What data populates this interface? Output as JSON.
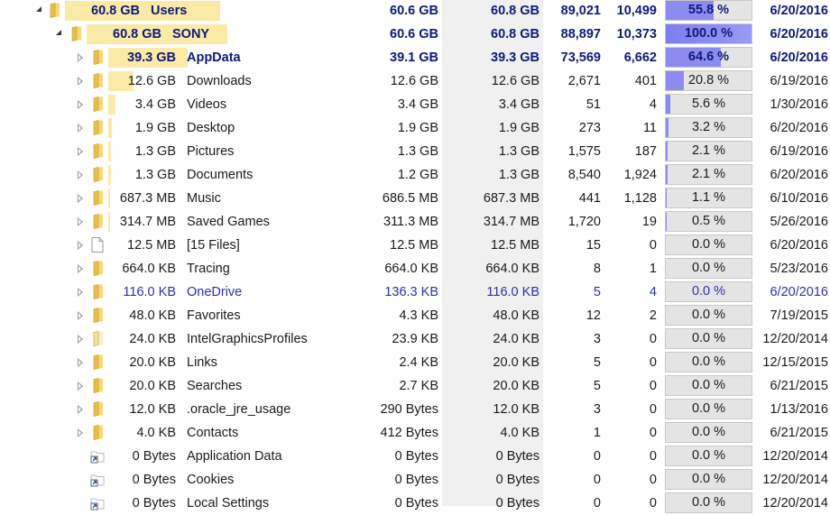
{
  "colors": {
    "size_bar": "#fbe9a6",
    "percent_fill": "#8c8cf0",
    "percent_bg": "#e4e4e4",
    "bold_text": "#0d1a7a",
    "link_text": "#2f2fb0",
    "allocated_column_bg": "#f0f0f0"
  },
  "rows": [
    {
      "level": 0,
      "expanded": true,
      "icon": "folder-icon",
      "style": "bold",
      "bar": 1.0,
      "size": "60.8 GB",
      "name": "Users",
      "size2": "60.6 GB",
      "allocated": "60.8 GB",
      "files": "89,021",
      "folders": "10,499",
      "percent": "55.8 %",
      "percent_value": 0.558,
      "date": "6/20/2016"
    },
    {
      "level": 1,
      "expanded": true,
      "icon": "folder-icon",
      "style": "bold",
      "bar": 1.0,
      "size": "60.8 GB",
      "name": "SONY",
      "size2": "60.6 GB",
      "allocated": "60.8 GB",
      "files": "88,897",
      "folders": "10,373",
      "percent": "100.0 %",
      "percent_value": 1.0,
      "date": "6/20/2016"
    },
    {
      "level": 2,
      "expanded": false,
      "icon": "folder-icon",
      "style": "bold",
      "bar": 1.0,
      "size": "39.3 GB",
      "name": "AppData",
      "size2": "39.1 GB",
      "allocated": "39.3 GB",
      "files": "73,569",
      "folders": "6,662",
      "percent": "64.6 %",
      "percent_value": 0.646,
      "date": "6/20/2016"
    },
    {
      "level": 2,
      "expanded": false,
      "icon": "folder-icon",
      "style": "normal",
      "bar": 0.32,
      "size": "12.6 GB",
      "name": "Downloads",
      "size2": "12.6 GB",
      "allocated": "12.6 GB",
      "files": "2,671",
      "folders": "401",
      "percent": "20.8 %",
      "percent_value": 0.208,
      "date": "6/19/2016"
    },
    {
      "level": 2,
      "expanded": false,
      "icon": "folder-icon",
      "style": "normal",
      "bar": 0.087,
      "size": "3.4 GB",
      "name": "Videos",
      "size2": "3.4 GB",
      "allocated": "3.4 GB",
      "files": "51",
      "folders": "4",
      "percent": "5.6 %",
      "percent_value": 0.056,
      "date": "1/30/2016"
    },
    {
      "level": 2,
      "expanded": false,
      "icon": "folder-icon",
      "style": "normal",
      "bar": 0.048,
      "size": "1.9 GB",
      "name": "Desktop",
      "size2": "1.9 GB",
      "allocated": "1.9 GB",
      "files": "273",
      "folders": "11",
      "percent": "3.2 %",
      "percent_value": 0.032,
      "date": "6/20/2016"
    },
    {
      "level": 2,
      "expanded": false,
      "icon": "folder-icon",
      "style": "normal",
      "bar": 0.033,
      "size": "1.3 GB",
      "name": "Pictures",
      "size2": "1.3 GB",
      "allocated": "1.3 GB",
      "files": "1,575",
      "folders": "187",
      "percent": "2.1 %",
      "percent_value": 0.021,
      "date": "6/19/2016"
    },
    {
      "level": 2,
      "expanded": false,
      "icon": "folder-icon",
      "style": "normal",
      "bar": 0.033,
      "size": "1.3 GB",
      "name": "Documents",
      "size2": "1.2 GB",
      "allocated": "1.3 GB",
      "files": "8,540",
      "folders": "1,924",
      "percent": "2.1 %",
      "percent_value": 0.021,
      "date": "6/20/2016"
    },
    {
      "level": 2,
      "expanded": false,
      "icon": "folder-icon",
      "style": "normal",
      "bar": 0.017,
      "size": "687.3 MB",
      "name": "Music",
      "size2": "686.5 MB",
      "allocated": "687.3 MB",
      "files": "441",
      "folders": "1,128",
      "percent": "1.1 %",
      "percent_value": 0.011,
      "date": "6/10/2016"
    },
    {
      "level": 2,
      "expanded": false,
      "icon": "folder-icon",
      "style": "normal",
      "bar": 0.008,
      "size": "314.7 MB",
      "name": "Saved Games",
      "size2": "311.3 MB",
      "allocated": "314.7 MB",
      "files": "1,720",
      "folders": "19",
      "percent": "0.5 %",
      "percent_value": 0.005,
      "date": "5/26/2016"
    },
    {
      "level": 2,
      "expanded": false,
      "icon": "file-icon",
      "style": "normal",
      "bar": 0.0,
      "size": "12.5 MB",
      "name": "[15 Files]",
      "size2": "12.5 MB",
      "allocated": "12.5 MB",
      "files": "15",
      "folders": "0",
      "percent": "0.0 %",
      "percent_value": 0.0,
      "date": "6/20/2016"
    },
    {
      "level": 2,
      "expanded": false,
      "icon": "folder-icon",
      "style": "normal",
      "bar": 0.0,
      "size": "664.0 KB",
      "name": "Tracing",
      "size2": "664.0 KB",
      "allocated": "664.0 KB",
      "files": "8",
      "folders": "1",
      "percent": "0.0 %",
      "percent_value": 0.0,
      "date": "5/23/2016"
    },
    {
      "level": 2,
      "expanded": false,
      "icon": "folder-icon",
      "style": "link",
      "bar": 0.0,
      "size": "116.0 KB",
      "name": "OneDrive",
      "size2": "136.3 KB",
      "allocated": "116.0 KB",
      "files": "5",
      "folders": "4",
      "percent": "0.0 %",
      "percent_value": 0.0,
      "date": "6/20/2016"
    },
    {
      "level": 2,
      "expanded": false,
      "icon": "folder-icon",
      "style": "normal",
      "bar": 0.0,
      "size": "48.0 KB",
      "name": "Favorites",
      "size2": "4.3 KB",
      "allocated": "48.0 KB",
      "files": "12",
      "folders": "2",
      "percent": "0.0 %",
      "percent_value": 0.0,
      "date": "7/19/2015"
    },
    {
      "level": 2,
      "expanded": false,
      "icon": "folder-faded-icon",
      "style": "normal",
      "bar": 0.0,
      "size": "24.0 KB",
      "name": "IntelGraphicsProfiles",
      "size2": "23.9 KB",
      "allocated": "24.0 KB",
      "files": "3",
      "folders": "0",
      "percent": "0.0 %",
      "percent_value": 0.0,
      "date": "12/20/2014"
    },
    {
      "level": 2,
      "expanded": false,
      "icon": "folder-icon",
      "style": "normal",
      "bar": 0.0,
      "size": "20.0 KB",
      "name": "Links",
      "size2": "2.4 KB",
      "allocated": "20.0 KB",
      "files": "5",
      "folders": "0",
      "percent": "0.0 %",
      "percent_value": 0.0,
      "date": "12/15/2015"
    },
    {
      "level": 2,
      "expanded": false,
      "icon": "folder-icon",
      "style": "normal",
      "bar": 0.0,
      "size": "20.0 KB",
      "name": "Searches",
      "size2": "2.7 KB",
      "allocated": "20.0 KB",
      "files": "5",
      "folders": "0",
      "percent": "0.0 %",
      "percent_value": 0.0,
      "date": "6/21/2015"
    },
    {
      "level": 2,
      "expanded": false,
      "icon": "folder-icon",
      "style": "normal",
      "bar": 0.0,
      "size": "12.0 KB",
      "name": ".oracle_jre_usage",
      "size2": "290 Bytes",
      "allocated": "12.0 KB",
      "files": "3",
      "folders": "0",
      "percent": "0.0 %",
      "percent_value": 0.0,
      "date": "1/13/2016"
    },
    {
      "level": 2,
      "expanded": false,
      "icon": "folder-icon",
      "style": "normal",
      "bar": 0.0,
      "size": "4.0 KB",
      "name": "Contacts",
      "size2": "412 Bytes",
      "allocated": "4.0 KB",
      "files": "1",
      "folders": "0",
      "percent": "0.0 %",
      "percent_value": 0.0,
      "date": "6/21/2015"
    },
    {
      "level": 2,
      "expanded": null,
      "icon": "shortcut-folder-icon",
      "style": "normal",
      "bar": 0.0,
      "size": "0 Bytes",
      "name": "Application Data",
      "size2": "0 Bytes",
      "allocated": "0 Bytes",
      "files": "0",
      "folders": "0",
      "percent": "0.0 %",
      "percent_value": 0.0,
      "date": "12/20/2014"
    },
    {
      "level": 2,
      "expanded": null,
      "icon": "shortcut-folder-icon",
      "style": "normal",
      "bar": 0.0,
      "size": "0 Bytes",
      "name": "Cookies",
      "size2": "0 Bytes",
      "allocated": "0 Bytes",
      "files": "0",
      "folders": "0",
      "percent": "0.0 %",
      "percent_value": 0.0,
      "date": "12/20/2014"
    },
    {
      "level": 2,
      "expanded": null,
      "icon": "shortcut-folder-icon",
      "style": "normal",
      "bar": 0.0,
      "size": "0 Bytes",
      "name": "Local Settings",
      "size2": "0 Bytes",
      "allocated": "0 Bytes",
      "files": "0",
      "folders": "0",
      "percent": "0.0 %",
      "percent_value": 0.0,
      "date": "12/20/2014"
    }
  ]
}
